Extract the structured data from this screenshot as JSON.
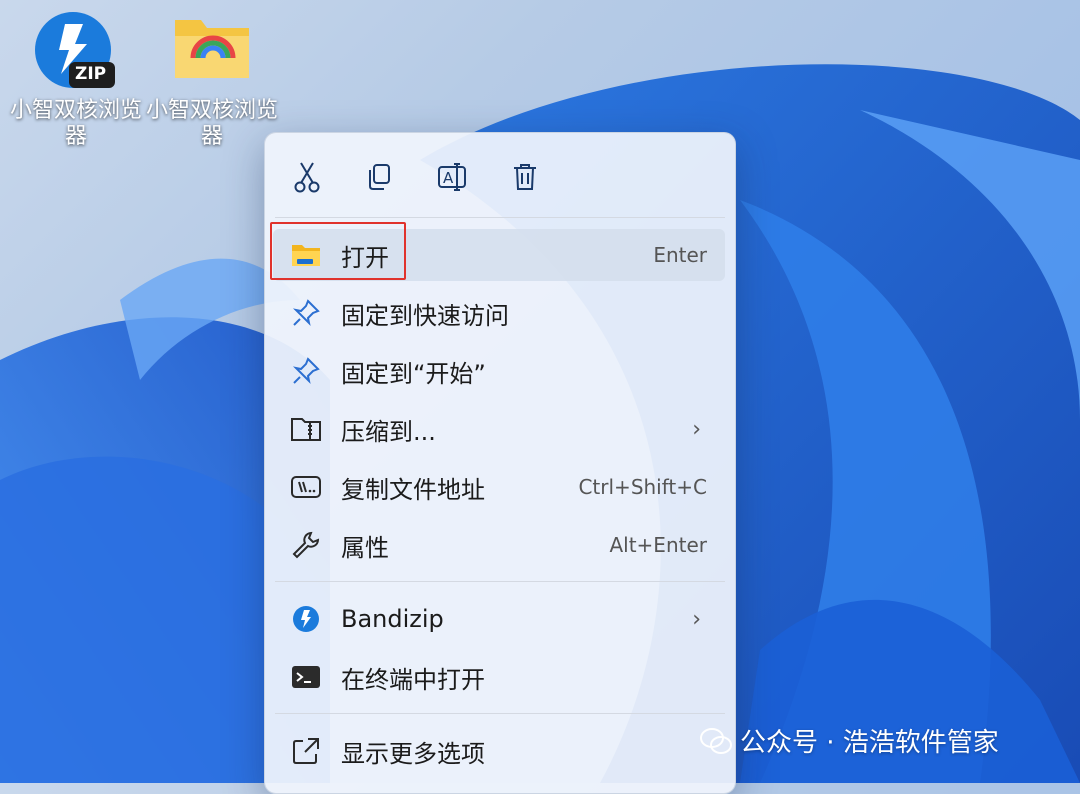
{
  "desktop": {
    "icons": [
      {
        "label": "小智双核浏览器",
        "badge": "ZIP"
      },
      {
        "label": "小智双核浏览器"
      }
    ]
  },
  "context_menu": {
    "toolbar": [
      {
        "icon": "scissors-icon"
      },
      {
        "icon": "copy-icon"
      },
      {
        "icon": "rename-icon"
      },
      {
        "icon": "trash-icon"
      }
    ],
    "items": [
      {
        "label": "打开",
        "shortcut": "Enter",
        "icon": "folder-icon"
      },
      {
        "label": "固定到快速访问",
        "shortcut": "",
        "icon": "pin-icon"
      },
      {
        "label": "固定到“开始”",
        "shortcut": "",
        "icon": "pin-icon"
      },
      {
        "label": "压缩到...",
        "shortcut": "",
        "icon": "zip-folder-icon"
      },
      {
        "label": "复制文件地址",
        "shortcut": "Ctrl+Shift+C",
        "icon": "path-icon"
      },
      {
        "label": "属性",
        "shortcut": "Alt+Enter",
        "icon": "wrench-icon"
      },
      {
        "label": "Bandizip",
        "shortcut": "",
        "icon": "bandizip-icon"
      },
      {
        "label": "在终端中打开",
        "shortcut": "",
        "icon": "terminal-icon"
      },
      {
        "label": "显示更多选项",
        "shortcut": "",
        "icon": "more-options-icon"
      }
    ]
  },
  "watermark": {
    "text": "公众号 · 浩浩软件管家"
  },
  "colors": {
    "accent": "#0067c0",
    "highlight": "#e0322c"
  }
}
